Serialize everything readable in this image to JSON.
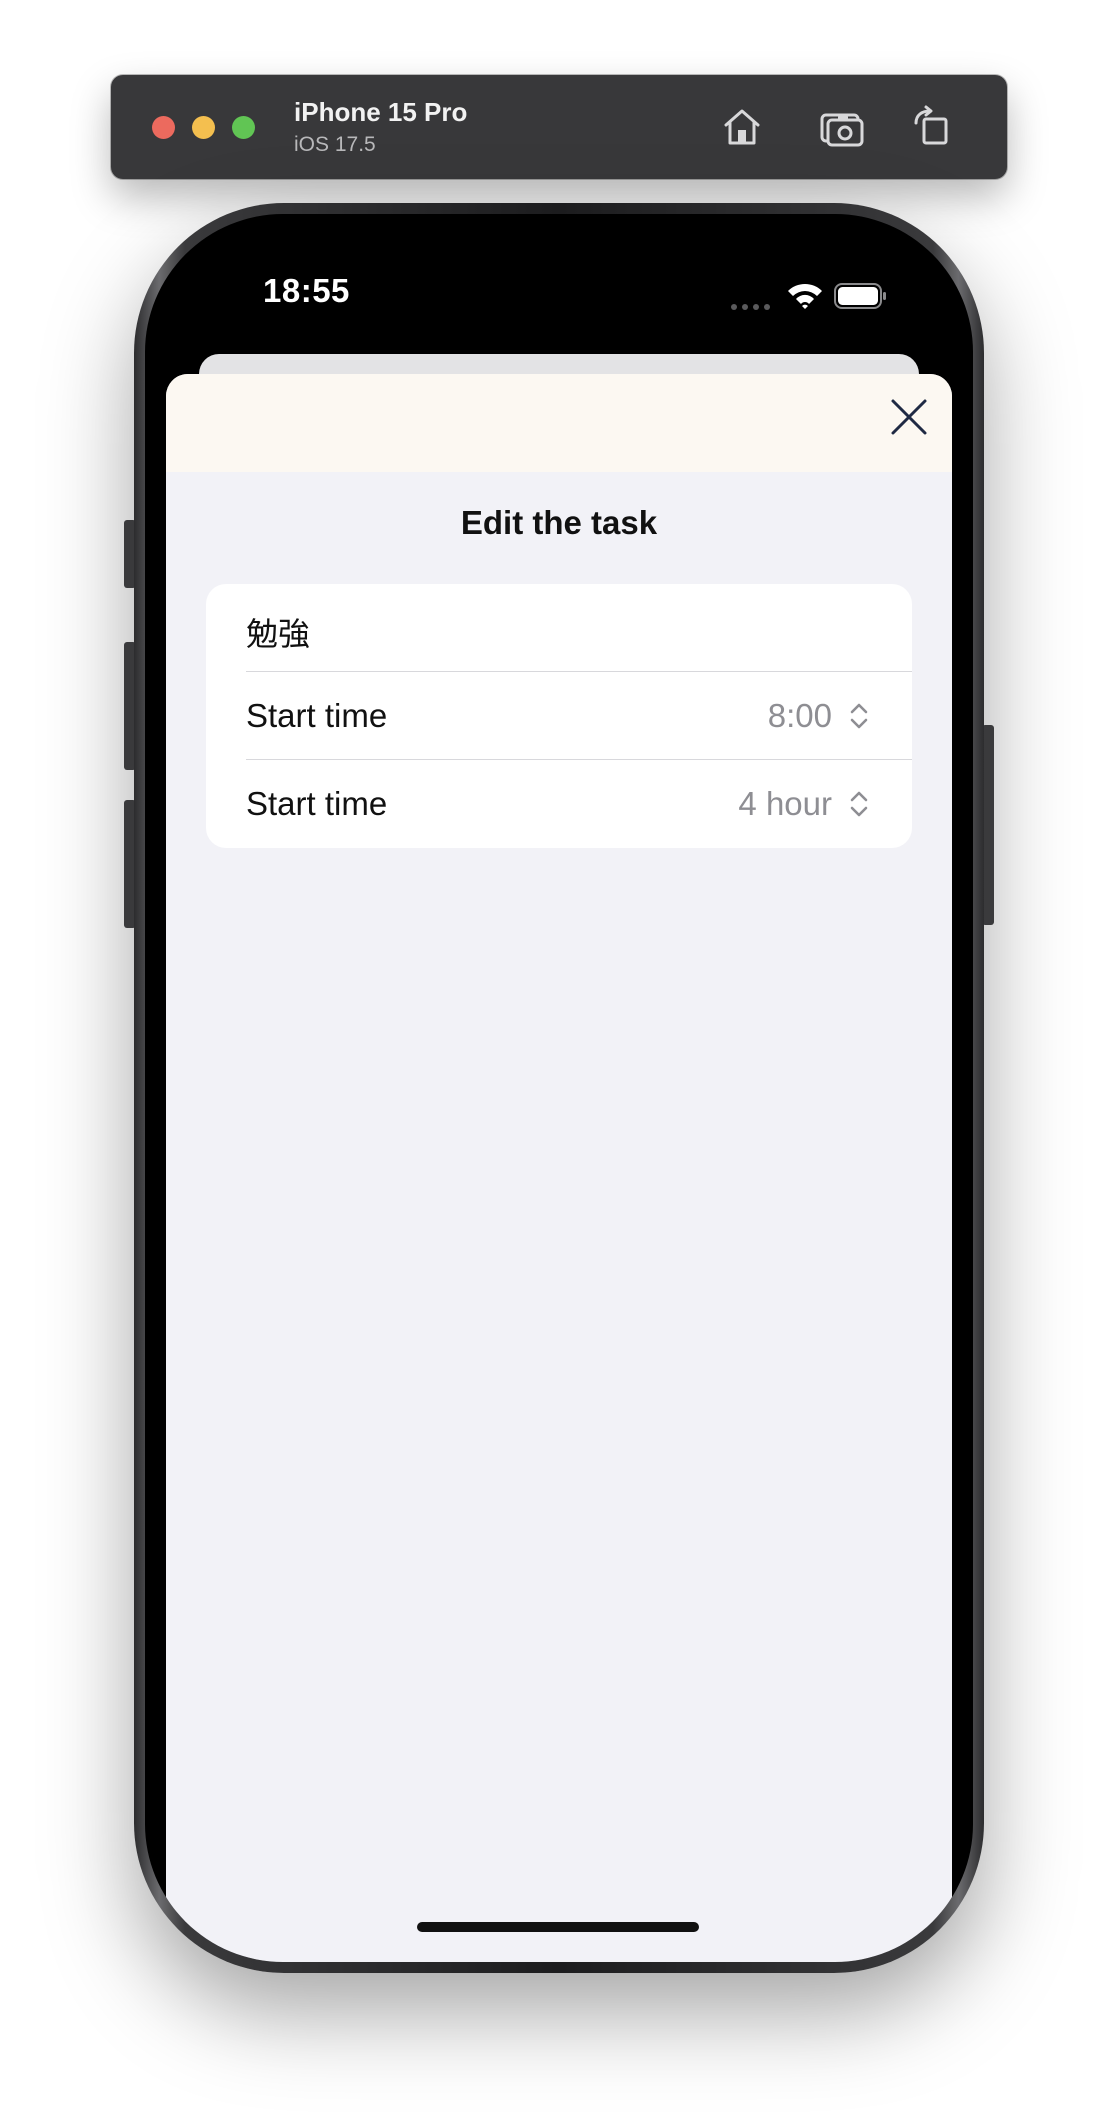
{
  "simulator": {
    "device_name": "iPhone 15 Pro",
    "os_version": "iOS 17.5",
    "icons": [
      "home-icon",
      "screenshot-icon",
      "rotate-icon"
    ]
  },
  "status_bar": {
    "time": "18:55"
  },
  "sheet": {
    "title": "Edit the task",
    "close_icon": "close-icon",
    "task_name": "勉強",
    "rows": [
      {
        "label": "Start time",
        "value": "8:00"
      },
      {
        "label": "Start time",
        "value": "4 hour"
      }
    ]
  },
  "colors": {
    "sheet_background": "#f2f2f7",
    "header_background": "#fcf8f2",
    "value_gray": "#8e8e93",
    "close_icon": "#1f2a44"
  }
}
